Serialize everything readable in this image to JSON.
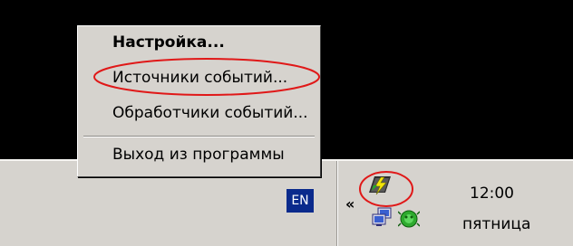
{
  "context_menu": {
    "items": [
      {
        "label": "Настройка...",
        "bold": true
      },
      {
        "label": "Источники событий..."
      },
      {
        "label": "Обработчики событий..."
      },
      {
        "label": "Выход из программы"
      }
    ]
  },
  "taskbar": {
    "language": "EN",
    "show_hidden_icons": "«",
    "clock": {
      "time": "12:00",
      "day": "пятница"
    }
  },
  "tray_icons": [
    "lightning-app-icon",
    "network-icon",
    "antivirus-icon"
  ],
  "colors": {
    "annotation_red": "#e01818",
    "taskbar": "#d6d3ce",
    "language_badge": "#0a2a8c"
  }
}
